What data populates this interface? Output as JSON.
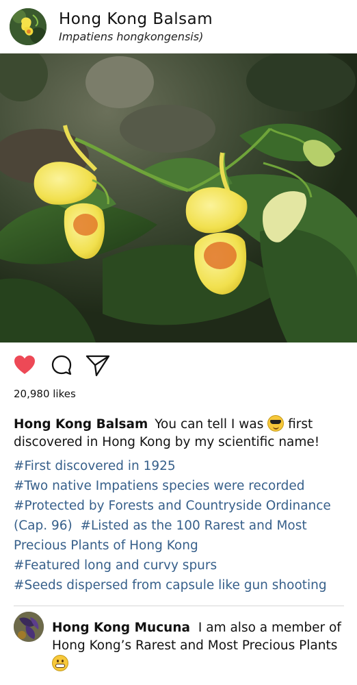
{
  "post": {
    "account_name": "Hong Kong Balsam",
    "scientific_name": "Impatiens hongkongensis)",
    "likes_text": "20,980 likes",
    "liked_color": "#ed4956"
  },
  "caption": {
    "user": "Hong Kong Balsam",
    "text_before_emoji": "You can tell I was",
    "emoji": "sunglasses-face",
    "text_after_emoji": "first discovered in Hong Kong by my scientific name!"
  },
  "hashtags": [
    "#First discovered in 1925",
    "#Two native Impatiens species were recorded",
    "#Protected by Forests and Countryside Ordinance (Cap. 96)",
    "#Listed as the 100 Rarest and Most Precious Plants of Hong Kong",
    "#Featured long and curvy spurs",
    "#Seeds dispersed from capsule like gun shooting"
  ],
  "hashtag_color": "#365f8a",
  "comment": {
    "user": "Hong Kong Mucuna",
    "text": "I am also a member of Hong Kong’s Rarest and Most Precious Plants",
    "emoji": "grimacing-face"
  },
  "icons": {
    "like": "heart-icon",
    "comment": "speech-bubble-icon",
    "share": "paper-plane-icon"
  }
}
